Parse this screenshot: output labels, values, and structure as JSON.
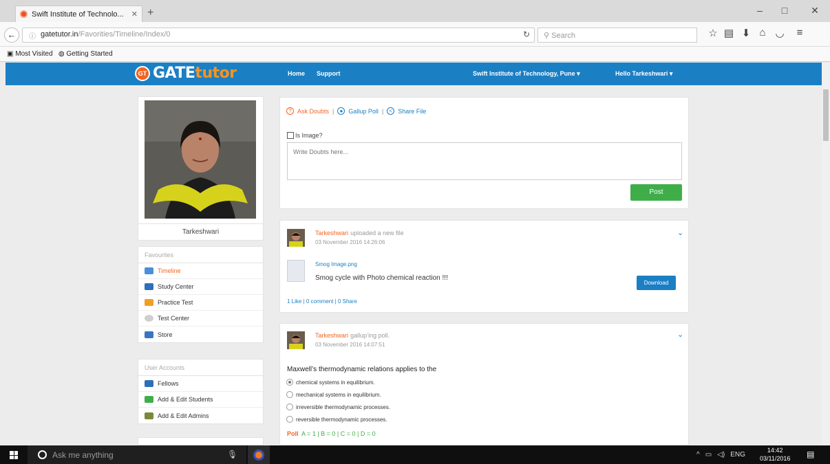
{
  "browser": {
    "tab_title": "Swift Institute of Technolo...",
    "url_domain": "gatetutor.in",
    "url_path": "/Favorities/Timeline/Index/0",
    "search_placeholder": "Search",
    "bookmarks": [
      "Most Visited",
      "Getting Started"
    ]
  },
  "header": {
    "logo_gate": "GATE",
    "logo_tutor": "tutor",
    "logo_badge": "GT",
    "nav": [
      "Home",
      "Support"
    ],
    "institute": "Swift Institute of Technology, Pune ▾",
    "greeting": "Hello Tarkeshwari ▾"
  },
  "profile": {
    "name": "Tarkeshwari"
  },
  "favourites": {
    "heading": "Favourites",
    "items": [
      "Timeline",
      "Study Center",
      "Practice Test",
      "Test Center",
      "Store"
    ]
  },
  "user_accounts": {
    "heading": "User Accounts",
    "items": [
      "Fellows",
      "Add & Edit Students",
      "Add & Edit Admins"
    ]
  },
  "composer": {
    "ask_doubts": "Ask Doubts",
    "gallup_poll": "Gallup Poll",
    "share_file": "Share File",
    "is_image": "Is Image?",
    "placeholder": "Write Doubts here...",
    "post_label": "Post"
  },
  "posts": [
    {
      "author": "Tarkeshwari",
      "action": "uploaded a new file",
      "date": "03 November 2016 14:26:06",
      "file_name": "Smog Image.png",
      "file_desc": "Smog cycle with Photo chemical reaction !!!",
      "download_label": "Download",
      "stats": "1 Like | 0 comment | 0 Share"
    },
    {
      "author": "Tarkeshwari",
      "action": "gallup’ing poll.",
      "date": "03 November 2016 14:07:51",
      "question": "Maxwell’s thermodynamic relations applies to the",
      "options": [
        "chemical systems in equilibrium.",
        "mechanical systems in equilibrium.",
        "irreversible thermodynamic processes.",
        "reversible thermodynamic processes."
      ],
      "poll_label": "Poll",
      "poll_results": "A = 1 | B = 0 | C = 0 | D = 0"
    }
  ],
  "taskbar": {
    "search_placeholder": "Ask me anything",
    "lang": "ENG",
    "time": "14:42",
    "date": "03/11/2016"
  },
  "colors": {
    "brand_blue": "#1b7fc4",
    "accent_orange": "#f26522",
    "post_green": "#3fae49"
  }
}
